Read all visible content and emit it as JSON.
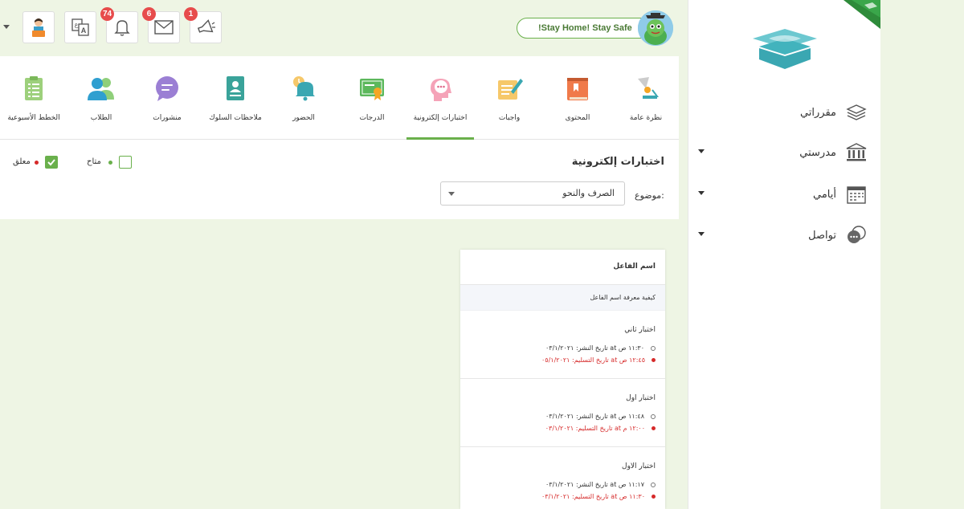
{
  "colors": {
    "accent": "#6ab04c",
    "badge": "#e74c4c",
    "due": "#d62a2a",
    "background": "#eef5e4"
  },
  "sidebar": {
    "items": [
      {
        "label": "مقرراتي",
        "icon": "books-icon",
        "has_dropdown": false
      },
      {
        "label": "مدرستي",
        "icon": "school-icon",
        "has_dropdown": true
      },
      {
        "label": "أيامي",
        "icon": "calendar-icon",
        "has_dropdown": true
      },
      {
        "label": "تواصل",
        "icon": "chat-icon",
        "has_dropdown": true
      }
    ]
  },
  "header": {
    "stay_home": "!Stay Home! Stay Safe",
    "tools": [
      {
        "name": "announcements",
        "icon": "megaphone-icon",
        "badge": "1"
      },
      {
        "name": "messages",
        "icon": "mail-icon",
        "badge": "6"
      },
      {
        "name": "notifications",
        "icon": "bell-icon",
        "badge": "74"
      },
      {
        "name": "language",
        "icon": "translate-icon",
        "badge": ""
      },
      {
        "name": "profile",
        "icon": "user-icon",
        "badge": ""
      }
    ]
  },
  "tabs": [
    {
      "label": "نظرة عامة",
      "icon": "lamp-icon",
      "active": false
    },
    {
      "label": "المحتوى",
      "icon": "book-icon",
      "active": false
    },
    {
      "label": "واجبات",
      "icon": "homework-icon",
      "active": false
    },
    {
      "label": "اختبارات إلكترونية",
      "icon": "quiz-icon",
      "active": true
    },
    {
      "label": "الدرجات",
      "icon": "certificate-icon",
      "active": false
    },
    {
      "label": "الحضور",
      "icon": "attendance-bell-icon",
      "active": false
    },
    {
      "label": "ملاحظات السلوك",
      "icon": "behavior-icon",
      "active": false
    },
    {
      "label": "منشورات",
      "icon": "posts-icon",
      "active": false
    },
    {
      "label": "الطلاب",
      "icon": "students-icon",
      "active": false
    },
    {
      "label": "الخطط الأسبوعية",
      "icon": "weekly-plan-icon",
      "active": false
    }
  ],
  "main": {
    "section_title": "اختبارات إلكترونية",
    "subject_label": "موضوع:",
    "subject_value": "الصرف والنحو",
    "legend": {
      "available": "متاح",
      "closed": "معلق"
    }
  },
  "card": {
    "title": "اسم الفاعل",
    "subtitle": "كيفية معرفة اسم الفاعل",
    "exams": [
      {
        "title": "اختبار ثاني",
        "published": "تاريخ النشر: ٠٣/١/٢٠٢١ at ١١:٣٠ ص",
        "due": "تاريخ التسليم: ٠٥/١/٢٠٢١ at ١٢:٤٥ ص"
      },
      {
        "title": "اختبار اول",
        "published": "تاريخ النشر: ٠٣/١/٢٠٢١ at ١١:٤٨ ص",
        "due": "تاريخ التسليم: ٠٣/١/٢٠٢١ at ١٢:٠٠ م"
      },
      {
        "title": "اختبار الاول",
        "published": "تاريخ النشر: ٠٣/١/٢٠٢١ at ١١:١٧ ص",
        "due": "تاريخ التسليم: ٠٣/١/٢٠٢١ at ١١:٣٠ ص"
      }
    ]
  }
}
